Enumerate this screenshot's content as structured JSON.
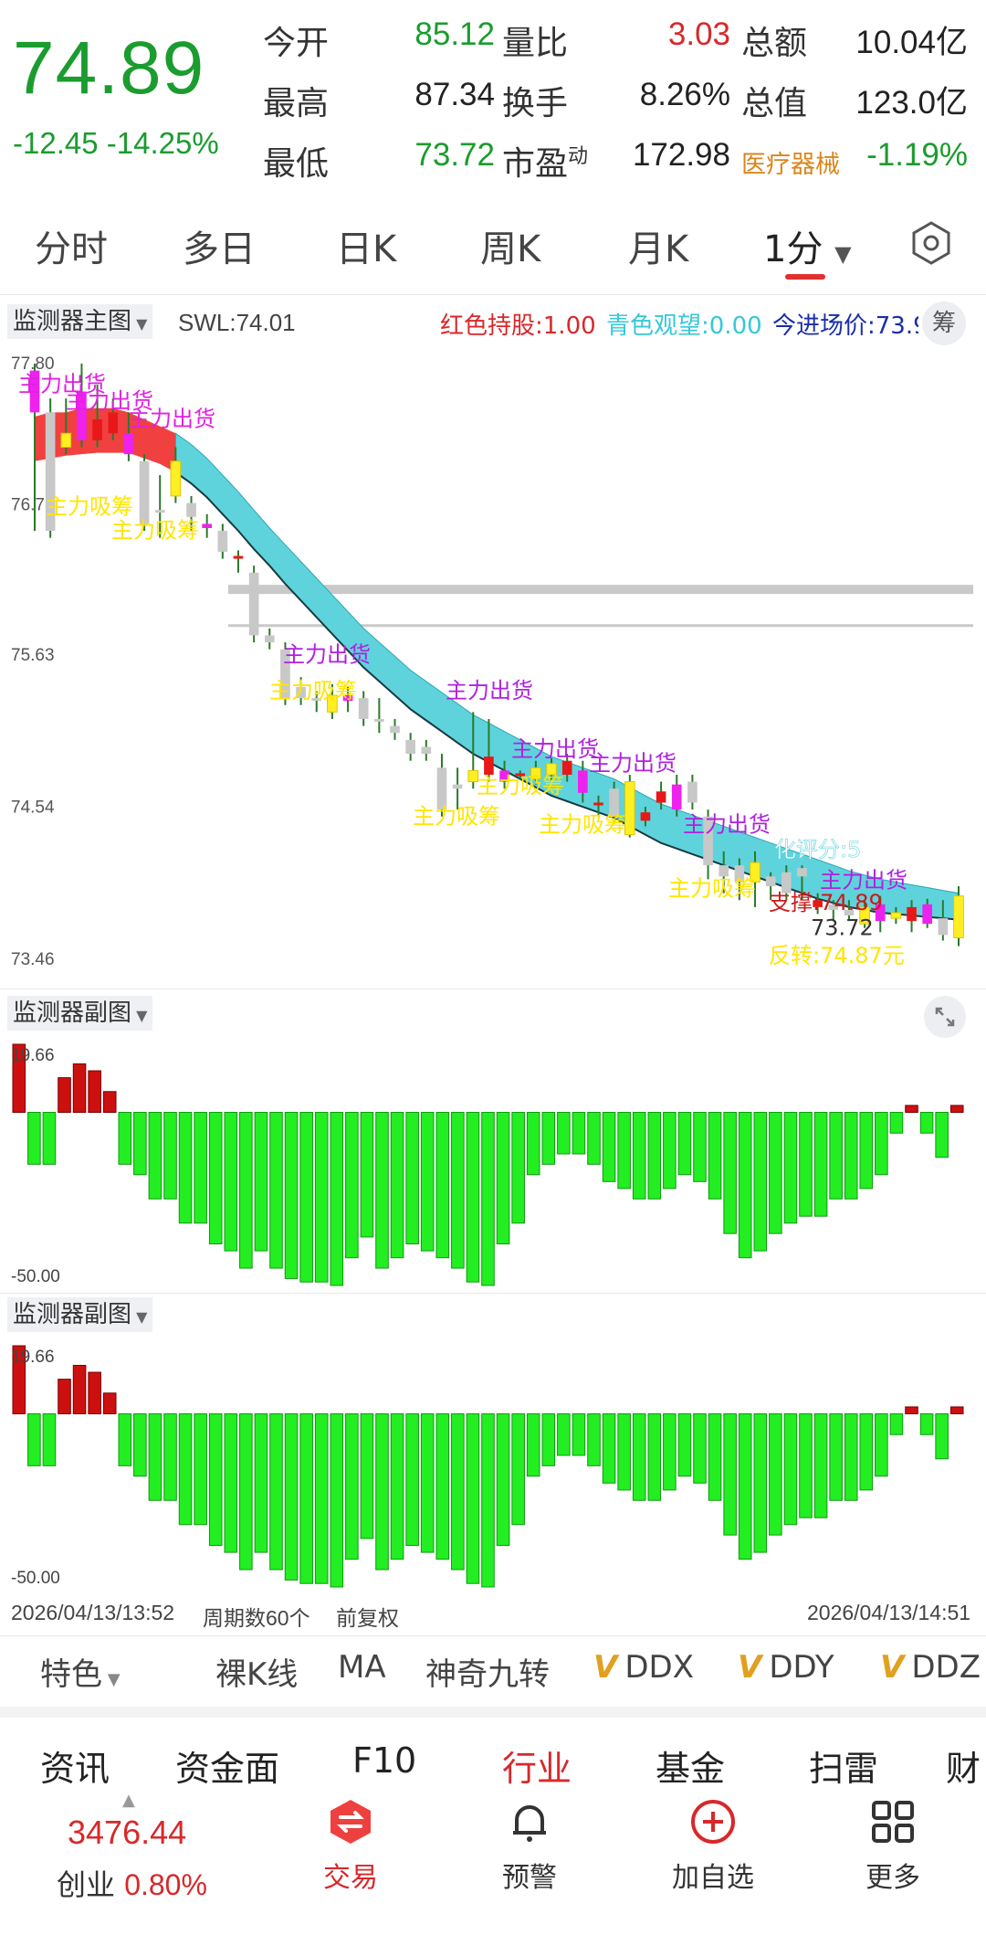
{
  "quote": {
    "price": "74.89",
    "change": "-12.45",
    "change_pct": "-14.25%",
    "stats": [
      {
        "label": "今开",
        "value": "85.12",
        "color": "green"
      },
      {
        "label": "量比",
        "value": "3.03",
        "color": "red"
      },
      {
        "label": "总额",
        "value": "10.04亿",
        "color": "dark"
      },
      {
        "label": "最高",
        "value": "87.34",
        "color": "dark"
      },
      {
        "label": "换手",
        "value": "8.26%",
        "color": "dark"
      },
      {
        "label": "总值",
        "value": "123.0亿",
        "color": "dark"
      },
      {
        "label": "最低",
        "value": "73.72",
        "color": "green"
      },
      {
        "label": "市盈",
        "sup": "动",
        "value": "172.98",
        "color": "dark"
      }
    ],
    "sector_name": "医疗器械",
    "sector_change": "-1.19%"
  },
  "period_tabs": [
    "分时",
    "多日",
    "日K",
    "周K",
    "月K",
    "1分"
  ],
  "active_period": "1分",
  "settings_icon": "hexagon-gear-icon",
  "main_panel": {
    "title": "监测器主图",
    "swl": "SWL:74.01",
    "legend_red": "红色持股:1.00",
    "legend_cyan": "青色观望:0.00",
    "legend_entry": "今进场价:73.9",
    "chip_button": "筹",
    "y_ticks": [
      "77.80",
      "76.71",
      "75.63",
      "74.54",
      "73.46"
    ],
    "annotations": [
      "主力出货",
      "主力出货",
      "主力出货",
      "主力吸筹",
      "主力吸筹",
      "主力出货",
      "主力吸筹",
      "主力出货",
      "主力出货",
      "主力出货",
      "主力吸筹",
      "主力吸筹",
      "主力吸筹",
      "主力出货",
      "主力吸筹",
      "主力出货",
      "支撑:74.89",
      "73.72",
      "反转:74.87元",
      "化评分:5"
    ]
  },
  "sub_panel_1": {
    "title": "监测器副图",
    "y_max": "19.66",
    "y_min": "-50.00"
  },
  "sub_panel_2": {
    "title": "监测器副图",
    "y_max": "19.66",
    "y_min": "-50.00"
  },
  "time_axis": {
    "start": "2026/04/13/13:52",
    "period_count": "周期数60个",
    "adjust": "前复权",
    "end": "2026/04/13/14:51"
  },
  "indicator_tabs": [
    "特色",
    "裸K线",
    "MA",
    "神奇九转",
    "DDX",
    "DDY",
    "DDZ"
  ],
  "function_tabs": [
    "资讯",
    "资金面",
    "F10",
    "行业",
    "基金",
    "扫雷",
    "财"
  ],
  "active_function_tab": "行业",
  "bottom_bar": {
    "index_value": "3476.44",
    "index_name": "创业",
    "index_change": "0.80%",
    "buttons": [
      {
        "label": "交易",
        "icon": "trade-exchange-icon"
      },
      {
        "label": "预警",
        "icon": "bell-icon"
      },
      {
        "label": "加自选",
        "icon": "plus-circle-icon"
      },
      {
        "label": "更多",
        "icon": "grid-more-icon"
      }
    ]
  },
  "chart_data": [
    {
      "type": "candlestick",
      "title": "监测器主图",
      "ylim": [
        73.46,
        77.8
      ],
      "y_ticks": [
        77.8,
        76.71,
        75.63,
        74.54,
        73.46
      ],
      "candles": [
        {
          "o": 77.75,
          "c": 77.45,
          "h": 77.8,
          "l": 76.6,
          "color": "magenta"
        },
        {
          "o": 77.45,
          "c": 76.6,
          "h": 77.55,
          "l": 76.55,
          "color": "gray"
        },
        {
          "o": 77.2,
          "c": 77.3,
          "h": 77.55,
          "l": 77.15,
          "color": "yellow"
        },
        {
          "o": 77.6,
          "c": 77.25,
          "h": 77.8,
          "l": 77.2,
          "color": "magenta"
        },
        {
          "o": 77.25,
          "c": 77.4,
          "h": 77.65,
          "l": 77.2,
          "color": "red"
        },
        {
          "o": 77.45,
          "c": 77.3,
          "h": 77.55,
          "l": 77.25,
          "color": "red"
        },
        {
          "o": 77.3,
          "c": 77.15,
          "h": 77.45,
          "l": 77.1,
          "color": "magenta"
        },
        {
          "o": 77.1,
          "c": 76.65,
          "h": 77.15,
          "l": 76.6,
          "color": "gray"
        },
        {
          "o": 76.75,
          "c": 76.75,
          "h": 77.0,
          "l": 76.55,
          "color": "gray"
        },
        {
          "o": 76.85,
          "c": 77.1,
          "h": 77.2,
          "l": 76.8,
          "color": "yellow"
        },
        {
          "o": 76.8,
          "c": 76.7,
          "h": 76.85,
          "l": 76.6,
          "color": "gray"
        },
        {
          "o": 76.65,
          "c": 76.62,
          "h": 76.72,
          "l": 76.55,
          "color": "magenta"
        },
        {
          "o": 76.6,
          "c": 76.45,
          "h": 76.65,
          "l": 76.4,
          "color": "gray"
        },
        {
          "o": 76.42,
          "c": 76.4,
          "h": 76.46,
          "l": 76.3,
          "color": "red"
        },
        {
          "o": 76.3,
          "c": 75.85,
          "h": 76.35,
          "l": 75.8,
          "color": "gray"
        },
        {
          "o": 75.85,
          "c": 75.8,
          "h": 75.9,
          "l": 75.75,
          "color": "gray"
        },
        {
          "o": 75.75,
          "c": 75.4,
          "h": 75.8,
          "l": 75.35,
          "color": "gray"
        },
        {
          "o": 75.48,
          "c": 75.4,
          "h": 75.55,
          "l": 75.35,
          "color": "gray"
        },
        {
          "o": 75.4,
          "c": 75.38,
          "h": 75.45,
          "l": 75.3,
          "color": "gray"
        },
        {
          "o": 75.42,
          "c": 75.3,
          "h": 75.5,
          "l": 75.25,
          "color": "yellow"
        },
        {
          "o": 75.42,
          "c": 75.38,
          "h": 75.48,
          "l": 75.3,
          "color": "magenta"
        },
        {
          "o": 75.4,
          "c": 75.25,
          "h": 75.45,
          "l": 75.2,
          "color": "gray"
        },
        {
          "o": 75.25,
          "c": 75.25,
          "h": 75.4,
          "l": 75.15,
          "color": "gray"
        },
        {
          "o": 75.2,
          "c": 75.15,
          "h": 75.25,
          "l": 75.1,
          "color": "gray"
        },
        {
          "o": 75.1,
          "c": 75.0,
          "h": 75.15,
          "l": 74.95,
          "color": "gray"
        },
        {
          "o": 75.05,
          "c": 75.0,
          "h": 75.1,
          "l": 74.95,
          "color": "gray"
        },
        {
          "o": 74.9,
          "c": 74.6,
          "h": 75.0,
          "l": 74.55,
          "color": "gray"
        },
        {
          "o": 74.75,
          "c": 74.78,
          "h": 74.9,
          "l": 74.6,
          "color": "gray"
        },
        {
          "o": 74.8,
          "c": 74.88,
          "h": 75.3,
          "l": 74.75,
          "color": "yellow"
        },
        {
          "o": 74.85,
          "c": 74.98,
          "h": 75.25,
          "l": 74.8,
          "color": "red"
        },
        {
          "o": 74.8,
          "c": 74.88,
          "h": 74.95,
          "l": 74.75,
          "color": "magenta"
        },
        {
          "o": 74.85,
          "c": 74.86,
          "h": 74.88,
          "l": 74.82,
          "color": "red"
        },
        {
          "o": 74.82,
          "c": 74.9,
          "h": 74.95,
          "l": 74.78,
          "color": "yellow"
        },
        {
          "o": 74.85,
          "c": 74.93,
          "h": 74.97,
          "l": 74.78,
          "color": "yellow"
        },
        {
          "o": 74.85,
          "c": 74.95,
          "h": 75.0,
          "l": 74.8,
          "color": "red"
        },
        {
          "o": 74.88,
          "c": 74.72,
          "h": 74.95,
          "l": 74.65,
          "color": "magenta"
        },
        {
          "o": 74.65,
          "c": 74.64,
          "h": 74.7,
          "l": 74.55,
          "color": "red"
        },
        {
          "o": 74.75,
          "c": 74.55,
          "h": 74.8,
          "l": 74.5,
          "color": "gray"
        },
        {
          "o": 74.8,
          "c": 74.42,
          "h": 74.85,
          "l": 74.4,
          "color": "yellow"
        },
        {
          "o": 74.58,
          "c": 74.52,
          "h": 74.62,
          "l": 74.48,
          "color": "red"
        },
        {
          "o": 74.65,
          "c": 74.73,
          "h": 74.8,
          "l": 74.6,
          "color": "red"
        },
        {
          "o": 74.78,
          "c": 74.6,
          "h": 74.85,
          "l": 74.55,
          "color": "magenta"
        },
        {
          "o": 74.8,
          "c": 74.65,
          "h": 74.85,
          "l": 74.6,
          "color": "gray"
        },
        {
          "o": 74.55,
          "c": 74.2,
          "h": 74.6,
          "l": 74.1,
          "color": "gray"
        },
        {
          "o": 74.2,
          "c": 74.12,
          "h": 74.3,
          "l": 74.0,
          "color": "gray"
        },
        {
          "o": 74.08,
          "c": 74.2,
          "h": 74.25,
          "l": 73.95,
          "color": "gray"
        },
        {
          "o": 74.22,
          "c": 74.08,
          "h": 74.3,
          "l": 73.9,
          "color": "yellow"
        },
        {
          "o": 74.12,
          "c": 74.05,
          "h": 74.15,
          "l": 73.95,
          "color": "gray"
        },
        {
          "o": 74.15,
          "c": 74.0,
          "h": 74.2,
          "l": 73.95,
          "color": "gray"
        },
        {
          "o": 74.18,
          "c": 74.12,
          "h": 74.2,
          "l": 73.95,
          "color": "gray"
        },
        {
          "o": 73.95,
          "c": 73.9,
          "h": 74.0,
          "l": 73.85,
          "color": "red"
        },
        {
          "o": 73.92,
          "c": 73.88,
          "h": 73.95,
          "l": 73.8,
          "color": "gray"
        },
        {
          "o": 73.88,
          "c": 73.84,
          "h": 73.95,
          "l": 73.8,
          "color": "gray"
        },
        {
          "o": 73.9,
          "c": 73.78,
          "h": 73.95,
          "l": 73.75,
          "color": "yellow"
        },
        {
          "o": 73.92,
          "c": 73.8,
          "h": 73.98,
          "l": 73.72,
          "color": "magenta"
        },
        {
          "o": 73.86,
          "c": 73.82,
          "h": 73.9,
          "l": 73.78,
          "color": "yellow"
        },
        {
          "o": 73.9,
          "c": 73.8,
          "h": 73.95,
          "l": 73.72,
          "color": "red"
        },
        {
          "o": 73.92,
          "c": 73.78,
          "h": 73.96,
          "l": 73.75,
          "color": "magenta"
        },
        {
          "o": 73.82,
          "c": 73.7,
          "h": 73.95,
          "l": 73.66,
          "color": "gray"
        },
        {
          "o": 73.68,
          "c": 73.98,
          "h": 74.05,
          "l": 73.62,
          "color": "yellow"
        }
      ],
      "band_upper": [
        77.42,
        77.45,
        77.45,
        77.48,
        77.48,
        77.48,
        77.45,
        77.4,
        77.35,
        77.3,
        77.22,
        77.12,
        77.0,
        76.88,
        76.75,
        76.62,
        76.5,
        76.38,
        76.26,
        76.14,
        76.02,
        75.9,
        75.8,
        75.7,
        75.6,
        75.52,
        75.44,
        75.36,
        75.28,
        75.22,
        75.16,
        75.1,
        75.04,
        74.98,
        74.94,
        74.9,
        74.86,
        74.82,
        74.76,
        74.7,
        74.64,
        74.6,
        74.56,
        74.52,
        74.48,
        74.44,
        74.4,
        74.36,
        74.32,
        74.28,
        74.24,
        74.2,
        74.16,
        74.13,
        74.1,
        74.08,
        74.06,
        74.04,
        74.02,
        74.0
      ],
      "band_lower": [
        77.1,
        77.12,
        77.14,
        77.15,
        77.16,
        77.16,
        77.16,
        77.12,
        77.08,
        77.02,
        76.94,
        76.84,
        76.72,
        76.6,
        76.47,
        76.35,
        76.22,
        76.1,
        75.98,
        75.86,
        75.74,
        75.62,
        75.52,
        75.42,
        75.32,
        75.24,
        75.16,
        75.08,
        75.0,
        74.94,
        74.88,
        74.82,
        74.76,
        74.7,
        74.66,
        74.62,
        74.58,
        74.54,
        74.48,
        74.42,
        74.36,
        74.32,
        74.28,
        74.24,
        74.2,
        74.16,
        74.12,
        74.08,
        74.04,
        74.0,
        73.96,
        73.93,
        73.9,
        73.88,
        73.86,
        73.85,
        73.84,
        73.83,
        73.82,
        73.81
      ],
      "band_red_until": 9,
      "horizontal_lines": [
        76.18,
        75.92
      ]
    },
    {
      "type": "bar",
      "title": "监测器副图",
      "ylim": [
        -50.0,
        19.66
      ],
      "values": [
        19.66,
        -15,
        -15,
        10,
        14,
        12,
        6,
        -15,
        -18,
        -25,
        -25,
        -32,
        -32,
        -38,
        -40,
        -45,
        -40,
        -45,
        -48,
        -49,
        -49,
        -50,
        -42,
        -36,
        -45,
        -42,
        -38,
        -40,
        -42,
        -45,
        -49,
        -50,
        -38,
        -32,
        -18,
        -15,
        -12,
        -12,
        -15,
        -20,
        -22,
        -25,
        -25,
        -22,
        -18,
        -20,
        -25,
        -35,
        -42,
        -40,
        -35,
        -32,
        -30,
        -30,
        -25,
        -25,
        -22,
        -18,
        -6,
        2,
        -6,
        -13,
        2
      ]
    },
    {
      "type": "bar",
      "title": "监测器副图",
      "ylim": [
        -50.0,
        19.66
      ],
      "values": [
        19.66,
        -15,
        -15,
        10,
        14,
        12,
        6,
        -15,
        -18,
        -25,
        -25,
        -32,
        -32,
        -38,
        -40,
        -45,
        -40,
        -45,
        -48,
        -49,
        -49,
        -50,
        -42,
        -36,
        -45,
        -42,
        -38,
        -40,
        -42,
        -45,
        -49,
        -50,
        -38,
        -32,
        -18,
        -15,
        -12,
        -12,
        -15,
        -20,
        -22,
        -25,
        -25,
        -22,
        -18,
        -20,
        -25,
        -35,
        -42,
        -40,
        -35,
        -32,
        -30,
        -30,
        -25,
        -25,
        -22,
        -18,
        -6,
        2,
        -6,
        -13,
        2
      ]
    }
  ]
}
